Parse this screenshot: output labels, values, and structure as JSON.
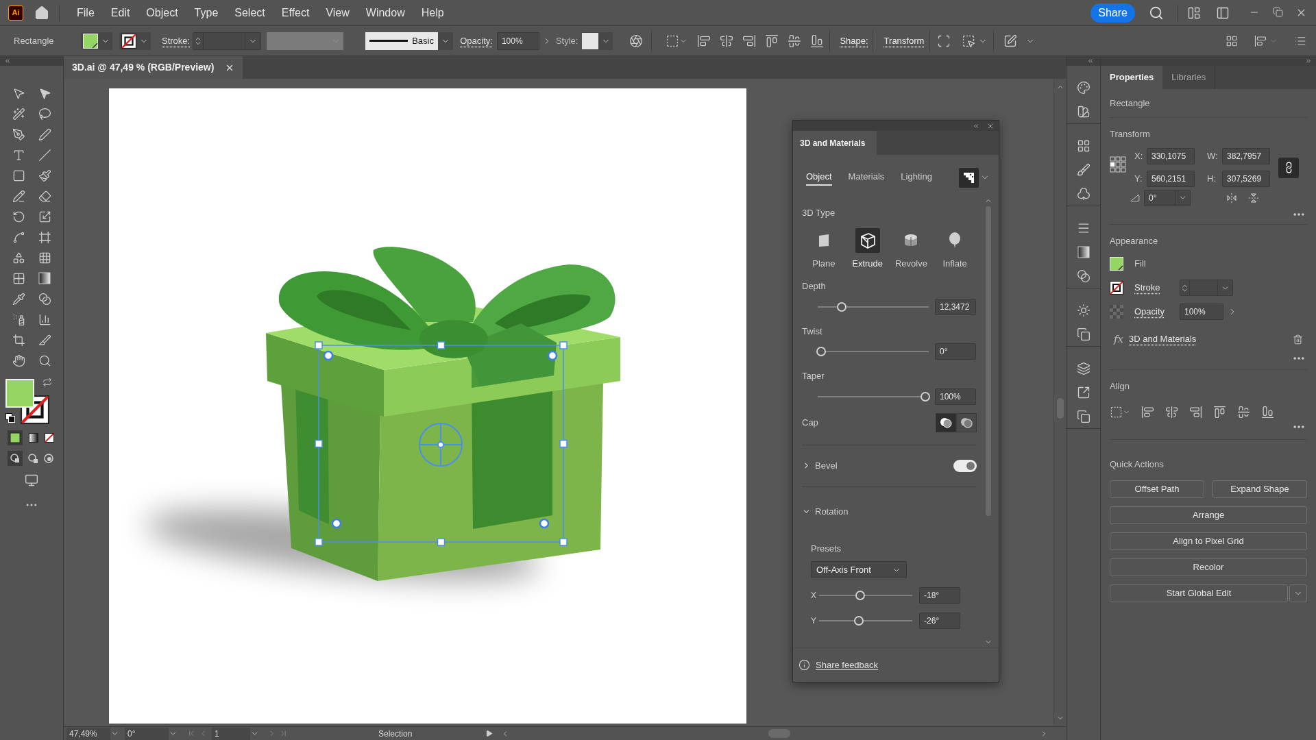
{
  "menu_bar": {
    "app_logo": "Ai",
    "menus": [
      "File",
      "Edit",
      "Object",
      "Type",
      "Select",
      "Effect",
      "View",
      "Window",
      "Help"
    ],
    "share_button": "Share"
  },
  "control_bar": {
    "object_type": "Rectangle",
    "stroke_label": "Stroke:",
    "brush": "Basic",
    "opacity_label": "Opacity:",
    "opacity": "100%",
    "style_label": "Style:",
    "shape_label": "Shape:",
    "transform_label": "Transform"
  },
  "document_tab": {
    "title": "3D.ai @ 47,49 % (RGB/Preview)"
  },
  "materials_panel": {
    "title": "3D and Materials",
    "tabs": [
      {
        "label": "Object",
        "selected": true
      },
      {
        "label": "Materials",
        "selected": false
      },
      {
        "label": "Lighting",
        "selected": false
      }
    ],
    "type_heading": "3D Type",
    "types": [
      {
        "kind": "plane",
        "label": "Plane",
        "selected": false
      },
      {
        "kind": "extrude",
        "label": "Extrude",
        "selected": true
      },
      {
        "kind": "revolve",
        "label": "Revolve",
        "selected": false
      },
      {
        "kind": "inflate",
        "label": "Inflate",
        "selected": false
      }
    ],
    "sliders": [
      {
        "label": "Depth",
        "level": 0.2,
        "value": "12,3472"
      },
      {
        "label": "Twist",
        "level": 0,
        "value": "0°"
      },
      {
        "label": "Taper",
        "level": 1,
        "value": "100%"
      }
    ],
    "cap": {
      "label": "Cap",
      "options": [
        {
          "kind": "solid",
          "selected": true
        },
        {
          "kind": "hollow",
          "selected": false
        }
      ]
    },
    "bevel": {
      "label": "Bevel",
      "expanded": false,
      "on": true
    },
    "rotation": {
      "label": "Rotation",
      "expanded": true,
      "presets_label": "Presets",
      "preset": "Off-Axis Front",
      "axes": [
        {
          "label": "X",
          "level": 0.44,
          "value": "-18°"
        },
        {
          "label": "Y",
          "level": 0.42,
          "value": "-26°"
        }
      ]
    },
    "feedback_link": "Share feedback"
  },
  "properties_panel": {
    "tabs": [
      {
        "label": "Properties",
        "selected": true
      },
      {
        "label": "Libraries",
        "selected": false
      }
    ],
    "object_type": "Rectangle",
    "transform": {
      "heading": "Transform",
      "fields": [
        {
          "label": "X:",
          "value": "330,1075"
        },
        {
          "label": "W:",
          "value": "382,7957"
        },
        {
          "label": "Y:",
          "value": "560,2151"
        },
        {
          "label": "H:",
          "value": "307,5269"
        }
      ],
      "angle": "0°",
      "proportions_linked": true
    },
    "appearance": {
      "heading": "Appearance",
      "fill_label": "Fill",
      "stroke_label": "Stroke",
      "opacity_label": "Opacity",
      "opacity": "100%",
      "effect_symbol": "fx",
      "effect": "3D and Materials"
    },
    "align": {
      "heading": "Align"
    },
    "quick_actions": {
      "heading": "Quick Actions",
      "buttons": [
        {
          "kind": "half",
          "label": "Offset Path"
        },
        {
          "kind": "half",
          "label": "Expand Shape"
        },
        {
          "kind": "full",
          "label": "Arrange"
        },
        {
          "kind": "full",
          "label": "Align to Pixel Grid"
        },
        {
          "kind": "full",
          "label": "Recolor"
        },
        {
          "kind": "split",
          "label": "Start Global Edit"
        }
      ]
    }
  },
  "status_bar": {
    "zoom": "47,49%",
    "rotation": "0°",
    "artboard": "1",
    "tool": "Selection"
  }
}
